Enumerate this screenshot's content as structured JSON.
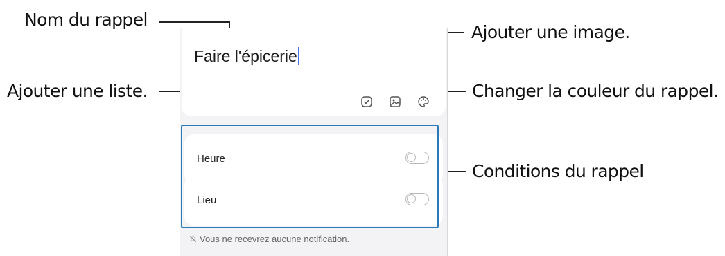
{
  "callouts": {
    "reminder_name": "Nom du rappel",
    "add_image": "Ajouter une image.",
    "add_list": "Ajouter une liste.",
    "change_color": "Changer la couleur du rappel.",
    "conditions": "Conditions du rappel"
  },
  "reminder": {
    "title": "Faire l'épicerie"
  },
  "conditions": {
    "time_label": "Heure",
    "place_label": "Lieu"
  },
  "notice": "Vous ne recevrez aucune notification.",
  "colors": {
    "highlight": "#2a7ab8",
    "caret": "#4a6ff0",
    "panel_bg": "#f3f3f5"
  }
}
